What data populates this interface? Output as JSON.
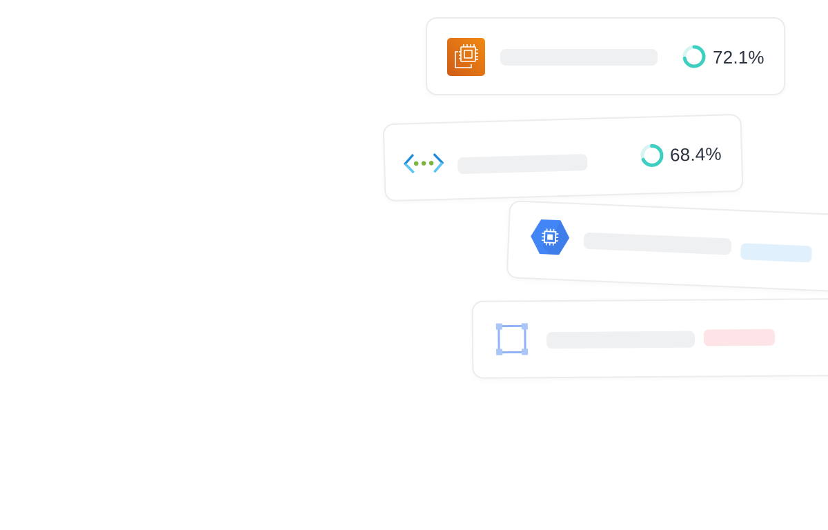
{
  "cards": [
    {
      "icon": "compute-instance-icon",
      "metric": {
        "value": "72.1%",
        "fraction": 0.721
      },
      "colors": {
        "icon_bg": "#e4730e",
        "ring": "#3fcfc0"
      }
    },
    {
      "icon": "virtual-network-icon",
      "metric": {
        "value": "68.4%",
        "fraction": 0.684
      },
      "colors": {
        "bracket": "#1f8ad9",
        "dots": "#7cb341",
        "ring": "#3fcfc0"
      }
    },
    {
      "icon": "compute-engine-chip-icon",
      "colors": {
        "hexagon": "#4285f4",
        "status_pill": "#e0f0fd"
      }
    },
    {
      "icon": "bounding-box-icon",
      "colors": {
        "frame": "#8fb3f5",
        "status_pill": "#fde4e6"
      }
    }
  ]
}
